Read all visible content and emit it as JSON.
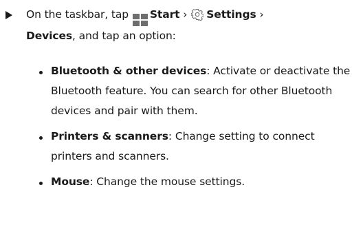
{
  "step": {
    "prefix": "On the taskbar, tap",
    "start_label": "Start",
    "sep1": " › ",
    "settings_label": "Settings",
    "sep2": " ›",
    "devices_label": "Devices",
    "suffix": ", and tap an option:",
    "start_icon": "windows-logo-icon",
    "settings_icon": "gear-icon"
  },
  "options": [
    {
      "title": "Bluetooth & other devices",
      "text": ": Activate or deactivate the Bluetooth feature. You can search for other Bluetooth devices and pair with them."
    },
    {
      "title": "Printers & scanners",
      "text": ": Change setting to connect printers and scanners."
    },
    {
      "title": "Mouse",
      "text": ": Change the mouse settings."
    }
  ],
  "colors": {
    "text": "#1a1a1a",
    "icon": "#6e6e6e"
  }
}
